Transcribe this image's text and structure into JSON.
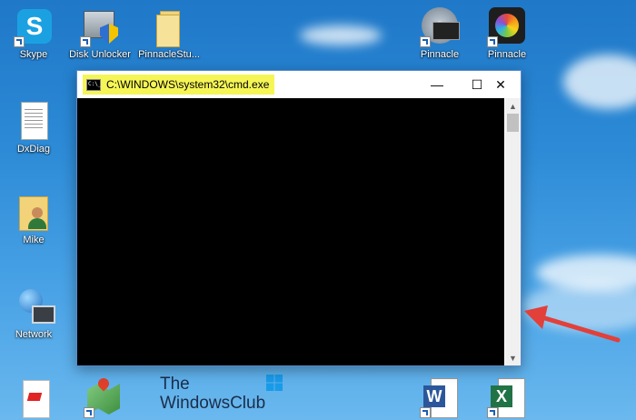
{
  "desktop": {
    "icons": [
      {
        "label": "Skype",
        "icon": "skype-icon"
      },
      {
        "label": "Disk Unlocker",
        "icon": "disk-unlocker-icon"
      },
      {
        "label": "PinnacleStu...",
        "icon": "folder-icon"
      },
      {
        "label": "Pinnacle",
        "icon": "pinnacle-dvd-icon"
      },
      {
        "label": "Pinnacle",
        "icon": "pinnacle-studio-icon"
      },
      {
        "label": "DxDiag",
        "icon": "document-icon"
      },
      {
        "label": "Mike",
        "icon": "user-folder-icon"
      },
      {
        "label": "Network",
        "icon": "network-icon"
      },
      {
        "label": "",
        "icon": "pdf-icon"
      },
      {
        "label": "",
        "icon": "maps-icon"
      },
      {
        "label": "",
        "icon": "word-icon"
      },
      {
        "label": "",
        "icon": "excel-icon"
      }
    ]
  },
  "cmd_window": {
    "title": "C:\\WINDOWS\\system32\\cmd.exe",
    "minimize": "—",
    "maximize": "☐",
    "close": "✕",
    "title_highlight": "#f5f556"
  },
  "watermark": {
    "line1": "The",
    "line2": "WindowsClub"
  },
  "annotation": {
    "arrow_color": "#e2403a"
  }
}
